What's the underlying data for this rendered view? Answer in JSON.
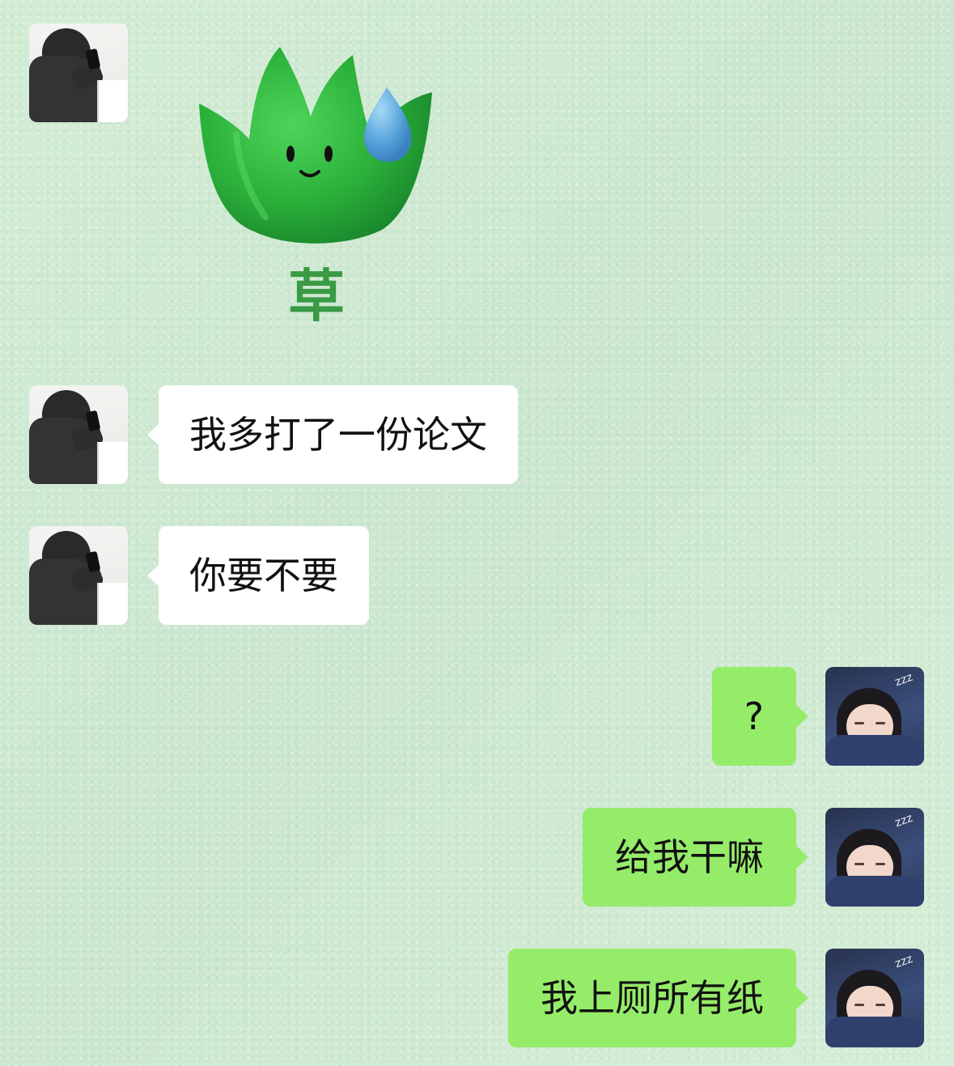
{
  "chat": {
    "messages": [
      {
        "sender": "them",
        "type": "sticker",
        "sticker_icon": "grass-crown-sweat-icon",
        "caption": "草"
      },
      {
        "sender": "them",
        "type": "text",
        "text": "我多打了一份论文"
      },
      {
        "sender": "them",
        "type": "text",
        "text": "你要不要"
      },
      {
        "sender": "me",
        "type": "text",
        "text": "?"
      },
      {
        "sender": "me",
        "type": "text",
        "text": "给我干嘛"
      },
      {
        "sender": "me",
        "type": "text",
        "text": "我上厕所有纸"
      }
    ],
    "colors": {
      "background": "#cfe9d2",
      "incoming_bubble": "#ffffff",
      "outgoing_bubble": "#95ec69",
      "sticker_green": "#2faa3e",
      "sticker_drop": "#5aa7de",
      "caption_green": "#3b9a45"
    }
  }
}
